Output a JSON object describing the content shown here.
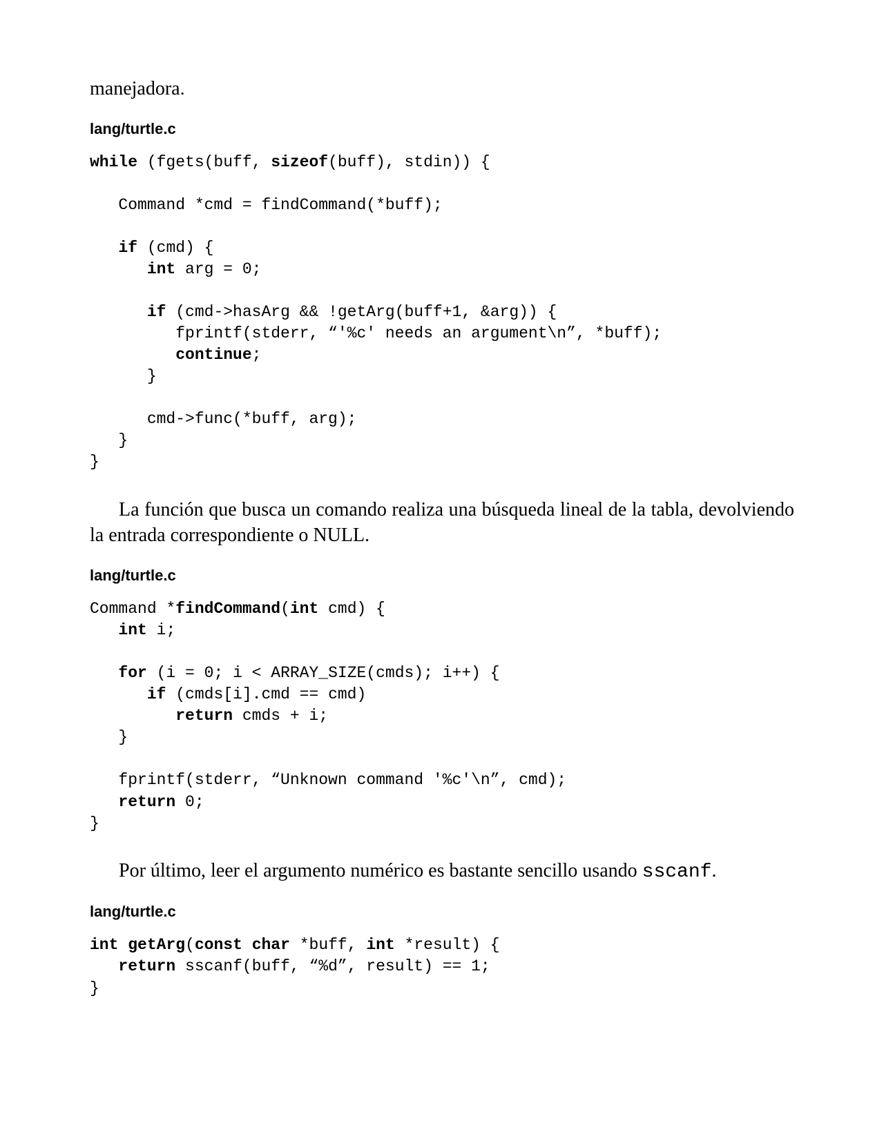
{
  "p1": "manejadora.",
  "file_label": "lang/turtle.c",
  "code1": {
    "l1a": "while",
    "l1b": " (fgets(buff, ",
    "l1c": "sizeof",
    "l1d": "(buff), stdin)) {",
    "l2": "   Command *cmd = findCommand(*buff);",
    "l3a": "   ",
    "l3b": "if",
    "l3c": " (cmd) {",
    "l4a": "      ",
    "l4b": "int",
    "l4c": " arg = 0;",
    "l5a": "      ",
    "l5b": "if",
    "l5c": " (cmd->hasArg && !getArg(buff+1, &arg)) {",
    "l6": "         fprintf(stderr, “'%c' needs an argument\\n”, *buff);",
    "l7a": "         ",
    "l7b": "continue",
    "l7c": ";",
    "l8": "      }",
    "l9": "      cmd->func(*buff, arg);",
    "l10": "   }",
    "l11": "}"
  },
  "p2": "La función que busca un comando realiza una búsqueda lineal de la tabla, devolviendo la entrada correspondiente o NULL.",
  "code2": {
    "l1a": "Command *",
    "l1b": "findCommand",
    "l1c": "(",
    "l1d": "int",
    "l1e": " cmd) {",
    "l2a": "   ",
    "l2b": "int",
    "l2c": " i;",
    "l3a": "   ",
    "l3b": "for",
    "l3c": " (i = 0; i < ARRAY_SIZE(cmds); i++) {",
    "l4a": "      ",
    "l4b": "if",
    "l4c": " (cmds[i].cmd == cmd)",
    "l5a": "         ",
    "l5b": "return",
    "l5c": " cmds + i;",
    "l6": "   }",
    "l7": "   fprintf(stderr, “Unknown command '%c'\\n”, cmd);",
    "l8a": "   ",
    "l8b": "return",
    "l8c": " 0;",
    "l9": "}"
  },
  "p3a": "Por último, leer el argumento numérico es bastante sencillo usando ",
  "p3b": "sscanf",
  "p3c": ".",
  "code3": {
    "l1a": "int",
    "l1b": " ",
    "l1c": "getArg",
    "l1d": "(",
    "l1e": "const",
    "l1f": " ",
    "l1g": "char",
    "l1h": " *buff, ",
    "l1i": "int",
    "l1j": " *result) {",
    "l2a": "   ",
    "l2b": "return",
    "l2c": " sscanf(buff, “%d”, result) == 1;",
    "l3": "}"
  }
}
